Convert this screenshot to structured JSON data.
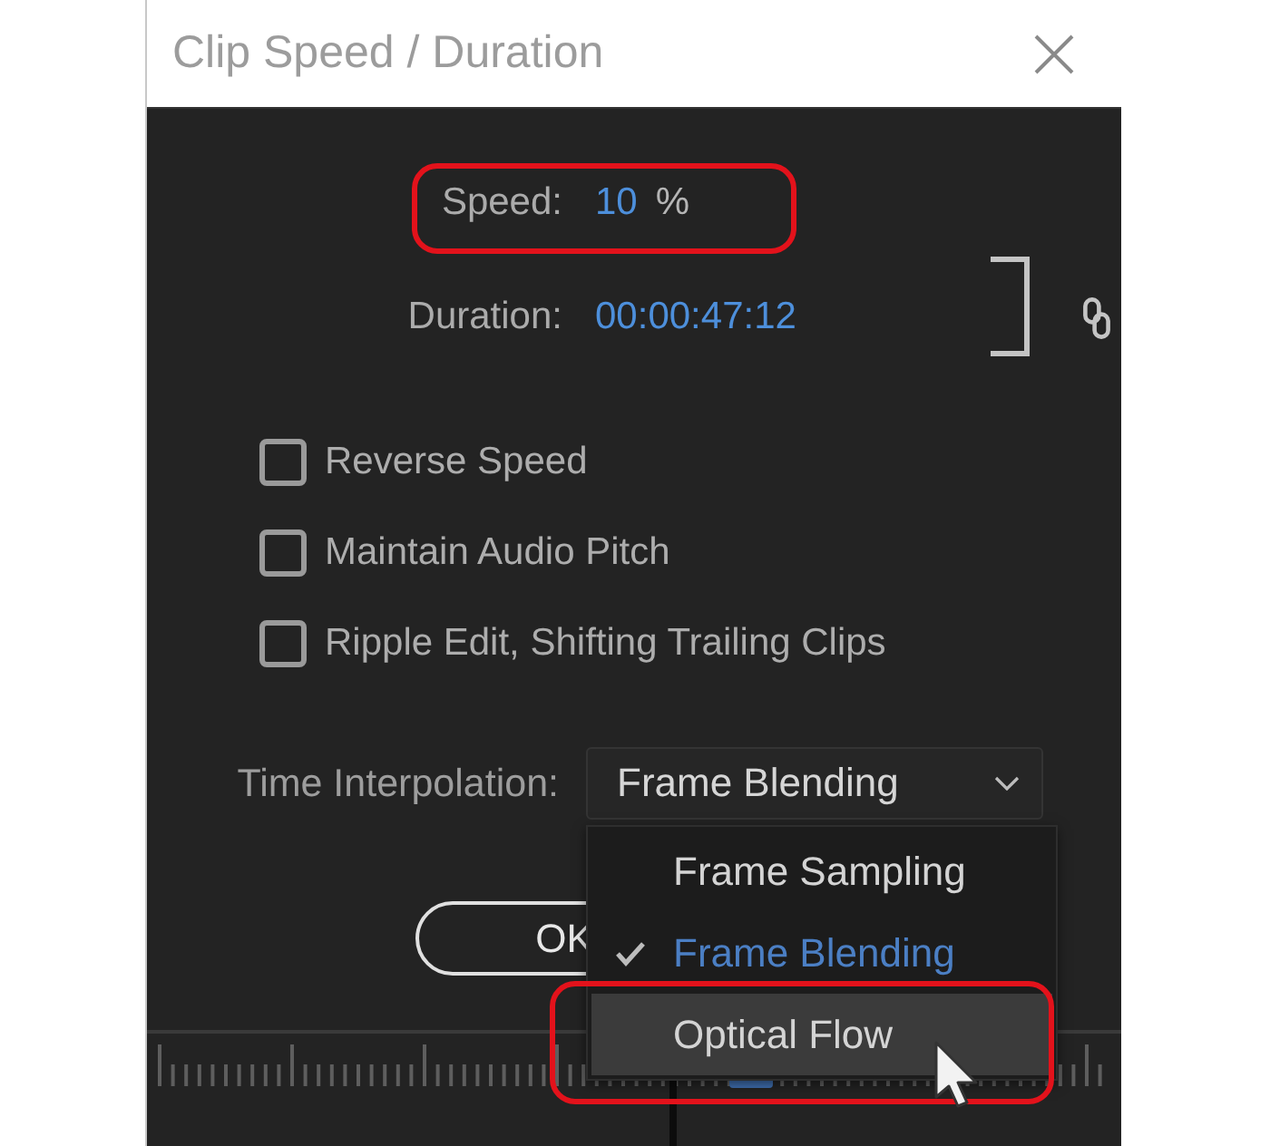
{
  "window": {
    "title": "Clip Speed / Duration"
  },
  "speed": {
    "label": "Speed:",
    "value": "10",
    "unit": "%",
    "annotated": true
  },
  "duration": {
    "label": "Duration:",
    "value": "00:00:47:12"
  },
  "options": [
    {
      "label": "Reverse Speed",
      "checked": false
    },
    {
      "label": "Maintain Audio Pitch",
      "checked": false
    },
    {
      "label": "Ripple Edit, Shifting Trailing Clips",
      "checked": false
    }
  ],
  "time_interpolation": {
    "label": "Time Interpolation:",
    "value": "Frame Blending",
    "expanded": true,
    "options": [
      {
        "label": "Frame Sampling",
        "selected": false,
        "hovered": false,
        "annotated": false
      },
      {
        "label": "Frame Blending",
        "selected": true,
        "hovered": false,
        "annotated": false
      },
      {
        "label": "Optical Flow",
        "selected": false,
        "hovered": true,
        "annotated": true
      }
    ]
  },
  "buttons": [
    {
      "label": "OK"
    }
  ]
}
